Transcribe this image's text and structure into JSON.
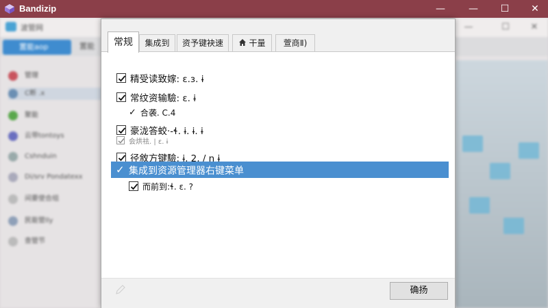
{
  "window": {
    "title": "Bandizip",
    "minimize_glyph": "—",
    "maximize_glyph": "☐",
    "close_glyph": "✕",
    "accent_color": "#8b3f49"
  },
  "background_window": {
    "title": "波管网",
    "primary_button": "置能aop",
    "second_tab": "置能",
    "sidebar_items": [
      "管理",
      "C断 .x",
      "聚能",
      "云带tontoys",
      "Cshnduin",
      "Di/srv Pondatexx",
      "间要使合组",
      "民能管lly",
      "查管节"
    ],
    "winbtn_min": "—",
    "winbtn_max": "☐",
    "winbtn_close": "✕"
  },
  "tabs": [
    {
      "label": "常规",
      "active": true
    },
    {
      "label": "集成到",
      "active": false
    },
    {
      "label": "资予键袂速",
      "active": false
    },
    {
      "label": "干量",
      "active": false,
      "icon": "home-icon"
    },
    {
      "label": "萱商Ⅱ)",
      "active": false
    }
  ],
  "options": {
    "o1": {
      "label": "精受读致嫁: ɛ.ɜ. ɨ",
      "checked": true
    },
    "o2": {
      "label": "常纹资输驗: ɛ. ɨ",
      "checked": true
    },
    "o2a": {
      "label": "合袭. C.4",
      "checked": true
    },
    "o3": {
      "label": "豪泷答蛟·-ɬ. ɨ. ɨ. ɨ",
      "checked": true
    },
    "o3a": {
      "label": "会烘祛. | ɛ. ɨ",
      "checked": true
    },
    "o4": {
      "label": "径敘方键驗: ɨ, 2, / n ɨ",
      "checked": true
    },
    "o5": {
      "label": "集成到资源管理器右键菜单",
      "checked": true,
      "highlighted": true
    },
    "o5a": {
      "label": "而前到:ɬ. ɛ. ?",
      "checked": true
    }
  },
  "highlight_color": "#4a8fd0",
  "footer": {
    "ok_label": "确扬"
  }
}
